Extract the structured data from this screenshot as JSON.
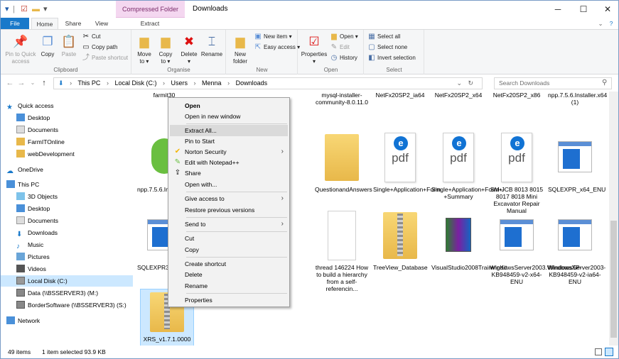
{
  "window": {
    "title": "Downloads",
    "context_tab": "Compressed Folder Tools",
    "controls": {
      "minimize": "─",
      "maximize": "☐",
      "close": "✕"
    }
  },
  "tabs": {
    "file": "File",
    "home": "Home",
    "share": "Share",
    "view": "View",
    "extract": "Extract"
  },
  "ribbon": {
    "clipboard": {
      "label": "Clipboard",
      "pin": "Pin to Quick\naccess",
      "copy": "Copy",
      "paste": "Paste",
      "cut": "Cut",
      "copy_path": "Copy path",
      "paste_shortcut": "Paste shortcut"
    },
    "organise": {
      "label": "Organise",
      "move_to": "Move\nto ▾",
      "copy_to": "Copy\nto ▾",
      "delete": "Delete\n▾",
      "rename": "Rename"
    },
    "new": {
      "label": "New",
      "new_folder": "New\nfolder",
      "new_item": "New item ▾",
      "easy_access": "Easy access ▾"
    },
    "open": {
      "label": "Open",
      "properties": "Properties\n▾",
      "open": "Open ▾",
      "edit": "Edit",
      "history": "History"
    },
    "select": {
      "label": "Select",
      "select_all": "Select all",
      "select_none": "Select none",
      "invert": "Invert selection"
    }
  },
  "address": {
    "path": [
      "This PC",
      "›",
      "Local Disk (C:)",
      "›",
      "Users",
      "›",
      "Menna",
      "›",
      "Downloads"
    ],
    "search_placeholder": "Search Downloads"
  },
  "nav": {
    "items": [
      "Quick access",
      "Desktop",
      "Documents",
      "FarmITOnline",
      "webDevelopment",
      "OneDrive",
      "This PC",
      "3D Objects",
      "Desktop",
      "Documents",
      "Downloads",
      "Music",
      "Pictures",
      "Videos",
      "Local Disk (C:)",
      "Data (\\\\BSSERVER3) (M:)",
      "BorderSoftware (\\\\BSSERVER3) (S:)",
      "Network"
    ]
  },
  "files": [
    {
      "name": "farmit30",
      "kind": "blank"
    },
    {
      "name": "mysql-installer-community-8.0.11.0",
      "kind": "blank"
    },
    {
      "name": "NetFx20SP2_ia64",
      "kind": "blank"
    },
    {
      "name": "NetFx20SP2_x64",
      "kind": "blank"
    },
    {
      "name": "NetFx20SP2_x86",
      "kind": "blank"
    },
    {
      "name": "npp.7.5.6.Installer.x64 (1)",
      "kind": "blank"
    },
    {
      "name": "npp.7.5.6.Installer.x64",
      "kind": "npp"
    },
    {
      "name": "QuestionandAnswers",
      "kind": "folder"
    },
    {
      "name": "Single+Application+Form",
      "kind": "pdf"
    },
    {
      "name": "Single+Application+Form+-+Summary",
      "kind": "pdf"
    },
    {
      "name": "SM-JCB 8013 8015 8017 8018 Mini Excavator Repair Manual",
      "kind": "pdf"
    },
    {
      "name": "SQLEXPR_x64_ENU",
      "kind": "exe"
    },
    {
      "name": "SQLEXPR32_x86_ENU",
      "kind": "exe"
    },
    {
      "name": "thread 146224 How to build a hierarchy from a self-referencin...",
      "kind": "blank"
    },
    {
      "name": "TreeView_Database",
      "kind": "zip"
    },
    {
      "name": "VisualStudio2008TrainingKit",
      "kind": "rar"
    },
    {
      "name": "WindowsServer2003.WindowsXP-KB948459-v2-x64-ENU",
      "kind": "exe"
    },
    {
      "name": "WindowsServer2003-KB948459-v2-ia64-ENU",
      "kind": "exe"
    },
    {
      "name": "XRS_v1.7.1.0000",
      "kind": "zip"
    }
  ],
  "context_menu": {
    "items": [
      "Open",
      "Open in new window",
      "Extract All...",
      "Pin to Start",
      "Norton Security",
      "Edit with Notepad++",
      "Share",
      "Open with...",
      "Give access to",
      "Restore previous versions",
      "Send to",
      "Cut",
      "Copy",
      "Create shortcut",
      "Delete",
      "Rename",
      "Properties"
    ]
  },
  "status": {
    "count": "49 items",
    "selected": "1 item selected  93.9 KB"
  },
  "colors": {
    "accent": "#1979ca",
    "selection": "#cce8ff",
    "context_tab": "#f4d7f0"
  }
}
